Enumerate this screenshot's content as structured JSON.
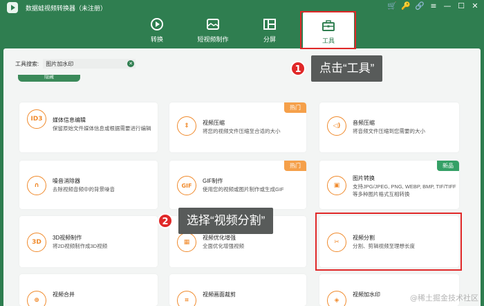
{
  "window": {
    "title": "数据蛙视频转换器（未注册）",
    "controls": [
      "🛒",
      "🔑",
      "🔗",
      "≡",
      "—",
      "☐",
      "✕"
    ]
  },
  "nav": {
    "tabs": [
      {
        "label": "转换",
        "icon": "convert-icon"
      },
      {
        "label": "短视频制作",
        "icon": "short-video-icon"
      },
      {
        "label": "分屏",
        "icon": "split-screen-icon"
      },
      {
        "label": "工具",
        "icon": "toolbox-icon",
        "active": true
      }
    ]
  },
  "search": {
    "label": "工具搜索:",
    "value": "图片加水印",
    "clear_icon": "✕"
  },
  "hidden_button": {
    "label": "隐藏"
  },
  "cards": [
    {
      "title": "媒体信息编辑",
      "desc": "保留原始文件媒体信息或根据需要进行编辑",
      "icon_text": "ID3",
      "badge": ""
    },
    {
      "title": "视频压缩",
      "desc": "将您的视频文件压缩至合适的大小",
      "icon_text": "⇕",
      "badge": "热门"
    },
    {
      "title": "音频压缩",
      "desc": "将音频文件压缩到您需要的大小",
      "icon_text": "◁)",
      "badge": ""
    },
    {
      "title": "噪音消除器",
      "desc": "去除视频音频中的背景噪音",
      "icon_text": "∩",
      "badge": ""
    },
    {
      "title": "GIF制作",
      "desc": "使用您的视频或图片制作或生成GIF",
      "icon_text": "GIF",
      "badge": "热门"
    },
    {
      "title": "图片转换",
      "desc": "支持JPG/JPEG, PNG, WEBP, BMP, TIF/TIFF等多种图片格式互相转换",
      "icon_text": "▣",
      "badge": "新品"
    },
    {
      "title": "3D视频制作",
      "desc": "将2D视频制作成3D视频",
      "icon_text": "3D",
      "badge": ""
    },
    {
      "title": "视频优化增强",
      "desc": "全面优化增强视频",
      "icon_text": "▦",
      "badge": ""
    },
    {
      "title": "视频分割",
      "desc": "分割、剪辑视频至理想长度",
      "icon_text": "✂",
      "badge": ""
    },
    {
      "title": "视频合并",
      "desc": "",
      "icon_text": "⊕",
      "badge": ""
    },
    {
      "title": "视频画面裁剪",
      "desc": "",
      "icon_text": "⌗",
      "badge": ""
    },
    {
      "title": "视频加水印",
      "desc": "",
      "icon_text": "◈",
      "badge": ""
    }
  ],
  "callouts": [
    {
      "number": "1",
      "text": "点击“工具”"
    },
    {
      "number": "2",
      "text": "选择“视频分割”"
    }
  ],
  "watermark": "@稀土掘金技术社区",
  "colors": {
    "brand_green": "#2f7e50",
    "icon_orange": "#f08a2c",
    "highlight_red": "#e02828",
    "badge_hot": "#f5a04a",
    "badge_new": "#35a066"
  }
}
